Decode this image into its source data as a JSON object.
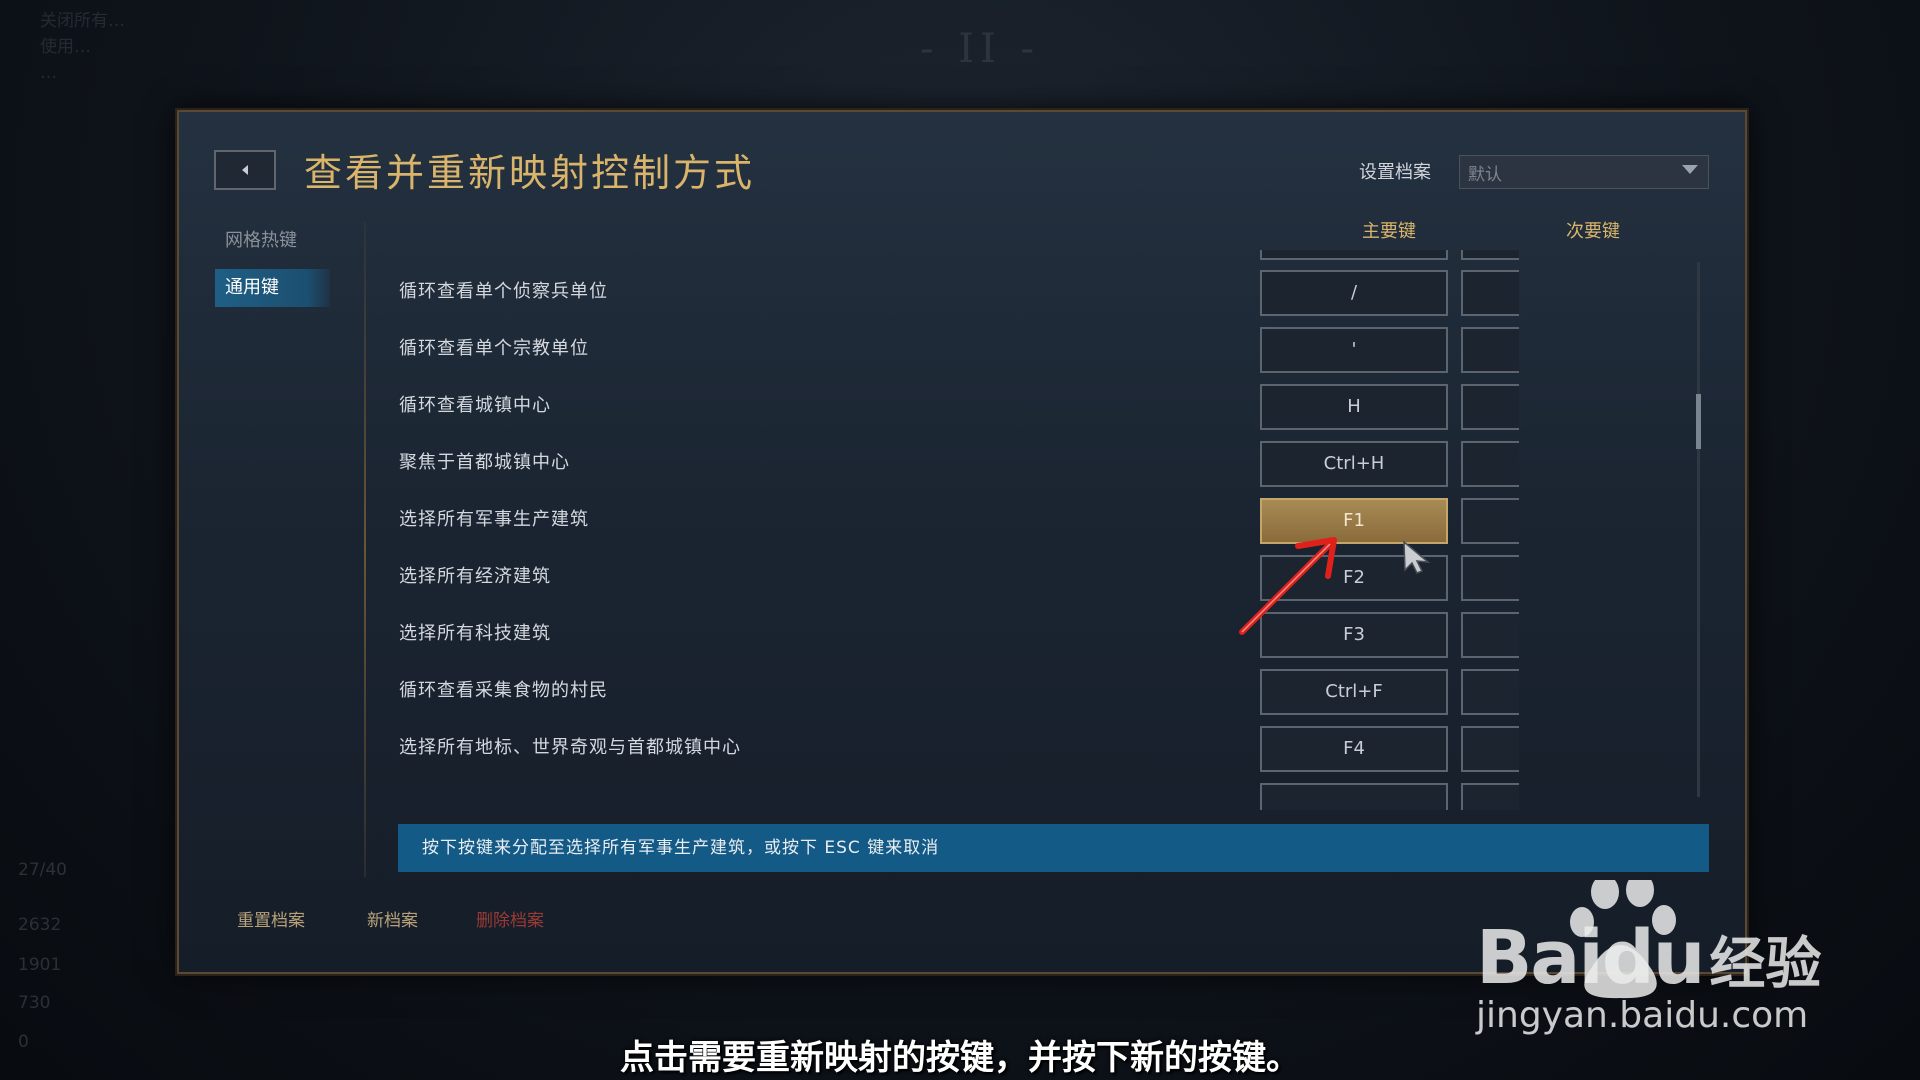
{
  "background": {
    "top_left_lines": [
      "关闭所有…",
      "使用…",
      "…"
    ],
    "roman": "- II -",
    "resources": [
      "27/40",
      "2632",
      "1901",
      "730",
      "0"
    ]
  },
  "dialog": {
    "back_icon": "chevron-left-icon",
    "title": "查看并重新映射控制方式",
    "profile_label": "设置档案",
    "profile_value": "默认",
    "nav": {
      "hotkeys": "网格热键",
      "general": "通用键"
    },
    "columns": {
      "primary": "主要键",
      "secondary": "次要键"
    },
    "rows": [
      {
        "label": "循环查看单个侦察兵单位",
        "primary": "/",
        "secondary": "空"
      },
      {
        "label": "循环查看单个宗教单位",
        "primary": "'",
        "secondary": "空"
      },
      {
        "label": "循环查看城镇中心",
        "primary": "H",
        "secondary": "空"
      },
      {
        "label": "聚焦于首都城镇中心",
        "primary": "Ctrl+H",
        "secondary": "空"
      },
      {
        "label": "选择所有军事生产建筑",
        "primary": "F1",
        "secondary": "空"
      },
      {
        "label": "选择所有经济建筑",
        "primary": "F2",
        "secondary": "空"
      },
      {
        "label": "选择所有科技建筑",
        "primary": "F3",
        "secondary": "空"
      },
      {
        "label": "循环查看采集食物的村民",
        "primary": "Ctrl+F",
        "secondary": "空"
      },
      {
        "label": "选择所有地标、世界奇观与首都城镇中心",
        "primary": "F4",
        "secondary": "空"
      }
    ],
    "status": "按下按键来分配至选择所有军事生产建筑，或按下 ESC 键来取消",
    "footer": {
      "reset": "重置档案",
      "new": "新档案",
      "delete": "删除档案"
    }
  },
  "watermark": {
    "brand": "Bai",
    "brand2": "du",
    "cn": "经验",
    "url": "jingyan.baidu.com"
  },
  "subtitle": "点击需要重新映射的按键，并按下新的按键。",
  "colors": {
    "accent_gold": "#d9b46a",
    "active_key": "#a88a55",
    "status_bar": "#145a86",
    "delete_red": "#9b3a35"
  }
}
